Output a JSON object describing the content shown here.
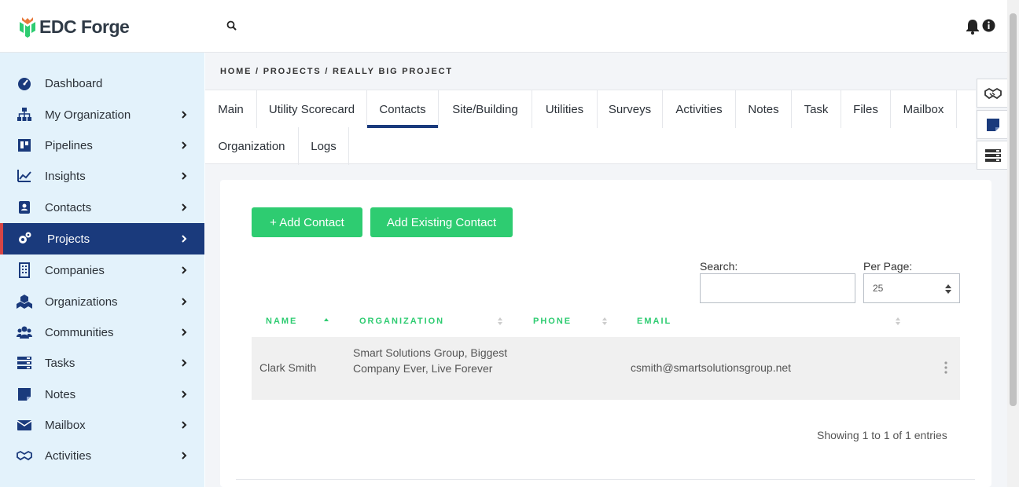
{
  "app": {
    "logo_text": "EDC Forge"
  },
  "header": {
    "search_icon": "search-icon",
    "bell_icon": "bell-icon",
    "info_icon": "info-icon"
  },
  "sidebar": {
    "items": [
      {
        "label": "Dashboard",
        "icon": "dashboard-icon",
        "has_chevron": false,
        "active": false
      },
      {
        "label": "My Organization",
        "icon": "org-chart-icon",
        "has_chevron": true,
        "active": false
      },
      {
        "label": "Pipelines",
        "icon": "pipeline-icon",
        "has_chevron": true,
        "active": false
      },
      {
        "label": "Insights",
        "icon": "chart-line-icon",
        "has_chevron": true,
        "active": false
      },
      {
        "label": "Contacts",
        "icon": "contact-card-icon",
        "has_chevron": true,
        "active": false
      },
      {
        "label": "Projects",
        "icon": "gears-icon",
        "has_chevron": true,
        "active": true
      },
      {
        "label": "Companies",
        "icon": "building-icon",
        "has_chevron": true,
        "active": false
      },
      {
        "label": "Organizations",
        "icon": "cubes-icon",
        "has_chevron": true,
        "active": false
      },
      {
        "label": "Communities",
        "icon": "users-icon",
        "has_chevron": true,
        "active": false
      },
      {
        "label": "Tasks",
        "icon": "tasks-icon",
        "has_chevron": true,
        "active": false
      },
      {
        "label": "Notes",
        "icon": "note-icon",
        "has_chevron": true,
        "active": false
      },
      {
        "label": "Mailbox",
        "icon": "envelope-icon",
        "has_chevron": true,
        "active": false
      },
      {
        "label": "Activities",
        "icon": "handshake-icon",
        "has_chevron": true,
        "active": false
      }
    ]
  },
  "breadcrumb": "HOME / PROJECTS / REALLY BIG PROJECT",
  "tabs": [
    {
      "label": "Main"
    },
    {
      "label": "Utility Scorecard"
    },
    {
      "label": "Contacts",
      "active": true
    },
    {
      "label": "Site/Building"
    },
    {
      "label": "Utilities"
    },
    {
      "label": "Surveys"
    },
    {
      "label": "Activities"
    },
    {
      "label": "Notes"
    },
    {
      "label": "Task"
    },
    {
      "label": "Files"
    },
    {
      "label": "Mailbox"
    },
    {
      "label": "Organization"
    },
    {
      "label": "Logs"
    }
  ],
  "right_tools": [
    "handshake-icon",
    "note-icon",
    "list-icon"
  ],
  "actions": {
    "add_contact": "+ Add Contact",
    "add_existing": "Add Existing Contact"
  },
  "filters": {
    "search_label": "Search:",
    "search_value": "",
    "per_page_label": "Per Page:",
    "per_page_value": "25"
  },
  "table": {
    "headers": [
      "NAME",
      "ORGANIZATION",
      "PHONE",
      "EMAIL"
    ],
    "rows": [
      {
        "name": "Clark Smith",
        "organization": "Smart Solutions Group, Biggest Company Ever, Live Forever",
        "phone": "",
        "email": "csmith@smartsolutionsgroup.net"
      }
    ],
    "footer": "Showing 1 to 1 of 1 entries"
  },
  "colors": {
    "accent_green": "#2ecc71",
    "nav_active": "#1a3a7c",
    "sidebar_bg": "#e3f2fb",
    "active_marker": "#d64545"
  }
}
